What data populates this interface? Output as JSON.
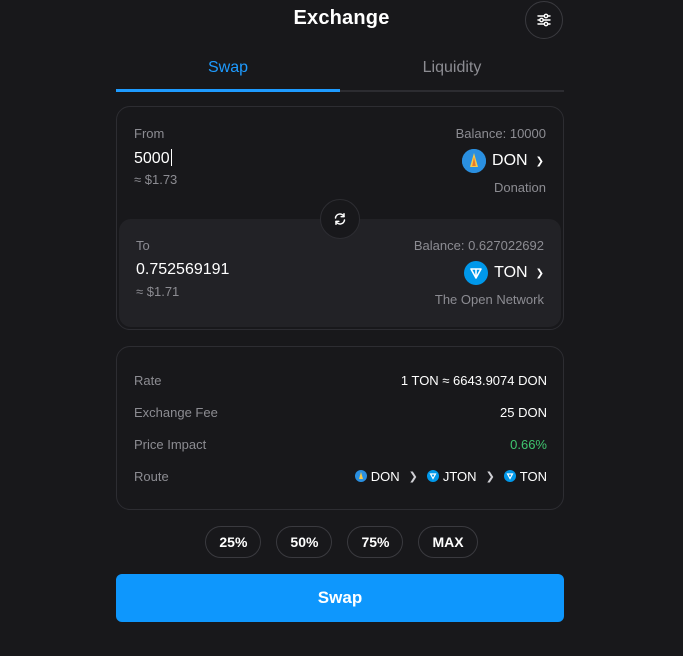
{
  "header": {
    "title": "Exchange",
    "settings_icon": "sliders-icon"
  },
  "tabs": [
    {
      "label": "Swap",
      "active": true
    },
    {
      "label": "Liquidity",
      "active": false
    }
  ],
  "from": {
    "label": "From",
    "amount": "5000",
    "usd": "≈ $1.73",
    "balance": "Balance: 10000",
    "token": "DON",
    "token_name": "Donation"
  },
  "to": {
    "label": "To",
    "amount": "0.752569191",
    "usd": "≈ $1.71",
    "balance": "Balance: 0.627022692",
    "token": "TON",
    "token_name": "The Open Network"
  },
  "info": {
    "rate_label": "Rate",
    "rate_value": "1 TON ≈ 6643.9074 DON",
    "fee_label": "Exchange Fee",
    "fee_value": "25 DON",
    "impact_label": "Price Impact",
    "impact_value": "0.66%",
    "route_label": "Route",
    "route": [
      "DON",
      "JTON",
      "TON"
    ]
  },
  "percent_buttons": [
    "25%",
    "50%",
    "75%",
    "MAX"
  ],
  "swap_button": "Swap",
  "colors": {
    "accent": "#0e97fd",
    "tab_active": "#1e9bff",
    "positive": "#3fc56f",
    "background": "#18181b"
  }
}
